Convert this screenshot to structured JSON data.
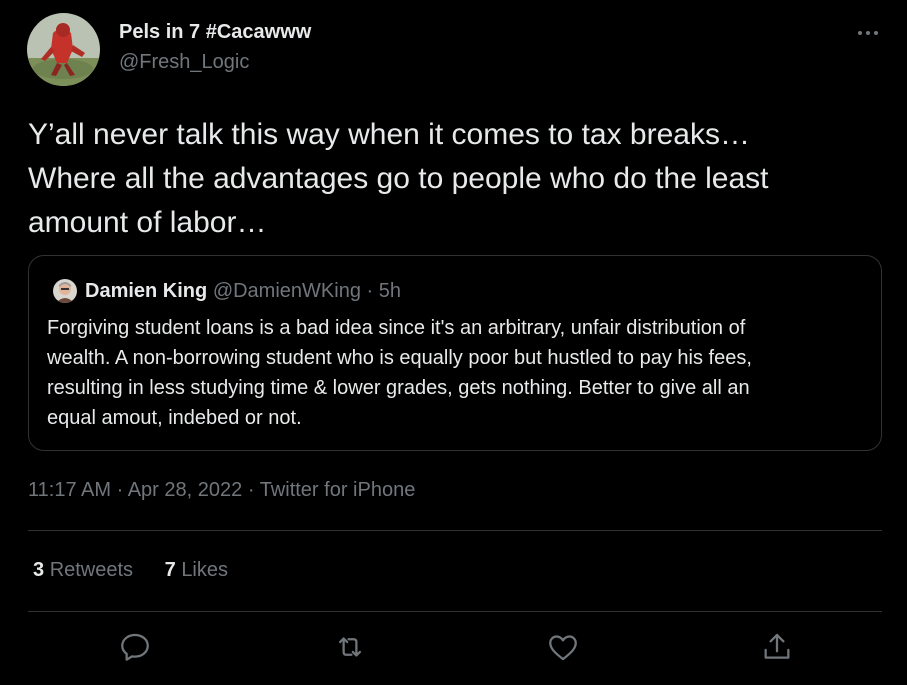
{
  "author": {
    "display_name": "Pels in 7 #Cacawww",
    "handle": "@Fresh_Logic"
  },
  "tweet": {
    "lines": [
      "Y’all never talk this way when it comes to tax breaks…",
      "Where all the advantages go to people who do the least",
      "amount of labor…"
    ]
  },
  "quote": {
    "name": "Damien King",
    "handle": "@DamienWKing",
    "separator": "·",
    "time": "5h",
    "lines": [
      "Forgiving student loans is a bad idea since it's an arbitrary, unfair distribution of",
      "wealth. A non-borrowing student who is equally poor but hustled to pay his fees,",
      "resulting in less studying time & lower grades, gets nothing. Better to give all an",
      "equal amout, indebed or not."
    ]
  },
  "meta": {
    "time": "11:17 AM",
    "sep1": "·",
    "date": "Apr 28, 2022",
    "sep2": "·",
    "source": "Twitter for iPhone"
  },
  "stats": {
    "retweets_count": "3",
    "retweets_label": "Retweets",
    "likes_count": "7",
    "likes_label": "Likes"
  },
  "icons": {
    "more": "more-icon",
    "reply": "reply-icon",
    "retweet": "retweet-icon",
    "like": "heart-icon",
    "share": "share-icon"
  },
  "colors": {
    "background": "#000000",
    "text_primary": "#e7e9ea",
    "text_secondary": "#71767b",
    "border": "#2f3336"
  }
}
